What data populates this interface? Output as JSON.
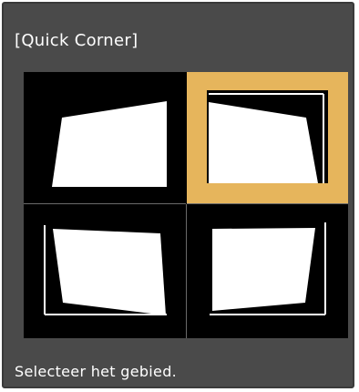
{
  "dialog": {
    "title": "[Quick Corner]",
    "status_text": "Selecteer het gebied."
  },
  "corners": [
    {
      "name": "top-left",
      "selected": false
    },
    {
      "name": "top-right",
      "selected": true
    },
    {
      "name": "bottom-left",
      "selected": false
    },
    {
      "name": "bottom-right",
      "selected": false
    }
  ],
  "colors": {
    "background": "#4a4a4a",
    "selection": "#e6b55c",
    "shape": "#ffffff"
  }
}
